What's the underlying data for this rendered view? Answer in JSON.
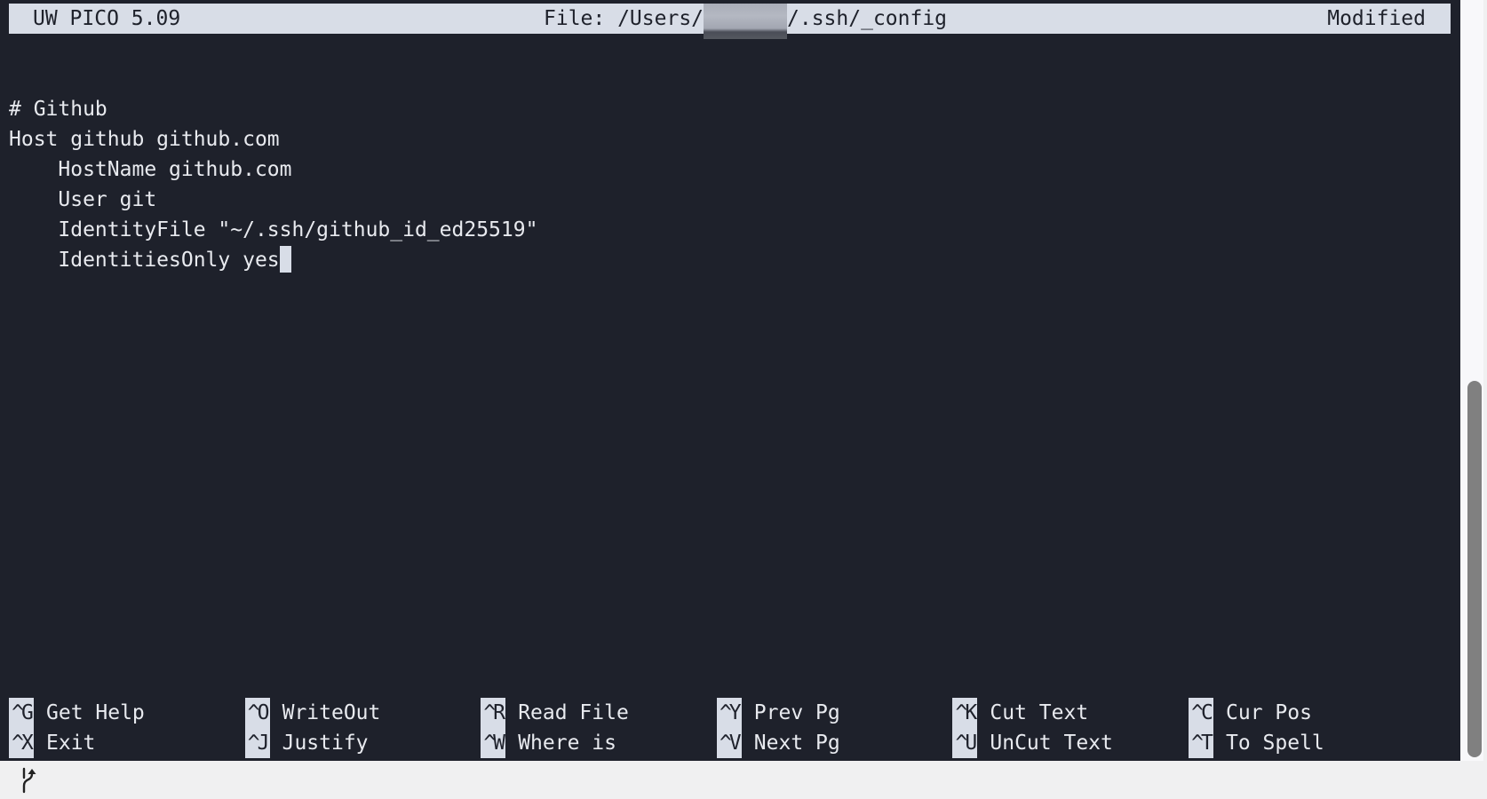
{
  "titlebar": {
    "app_name": "UW PICO 5.09",
    "file_prefix": "File: /Users/",
    "file_user_redacted": "",
    "file_suffix": "/.ssh/_config",
    "status": "Modified"
  },
  "editor": {
    "lines": [
      "",
      "# Github",
      "Host github github.com",
      "    HostName github.com",
      "    User git",
      "    IdentityFile \"~/.ssh/github_id_ed25519\"",
      "    IdentitiesOnly yes"
    ],
    "cursor": {
      "line": 7,
      "column": 19
    }
  },
  "shortcuts": [
    [
      {
        "key": "^G",
        "label": "Get Help"
      },
      {
        "key": "^O",
        "label": "WriteOut"
      },
      {
        "key": "^R",
        "label": "Read File"
      },
      {
        "key": "^Y",
        "label": "Prev Pg"
      },
      {
        "key": "^K",
        "label": "Cut Text"
      },
      {
        "key": "^C",
        "label": "Cur Pos"
      }
    ],
    [
      {
        "key": "^X",
        "label": "Exit"
      },
      {
        "key": "^J",
        "label": "Justify"
      },
      {
        "key": "^W",
        "label": "Where is"
      },
      {
        "key": "^V",
        "label": "Next Pg"
      },
      {
        "key": "^U",
        "label": "UnCut Text"
      },
      {
        "key": "^T",
        "label": "To Spell"
      }
    ]
  ],
  "scrollbar": {
    "position_fraction": 0.5,
    "visible_fraction": 0.5
  },
  "statusbar": {
    "icon": "branch-merge-icon"
  },
  "colors": {
    "terminal_bg": "#1e212b",
    "terminal_fg": "#e8eaef",
    "inverse_bg": "#d8dde7",
    "scrollbar_thumb": "#808080"
  }
}
